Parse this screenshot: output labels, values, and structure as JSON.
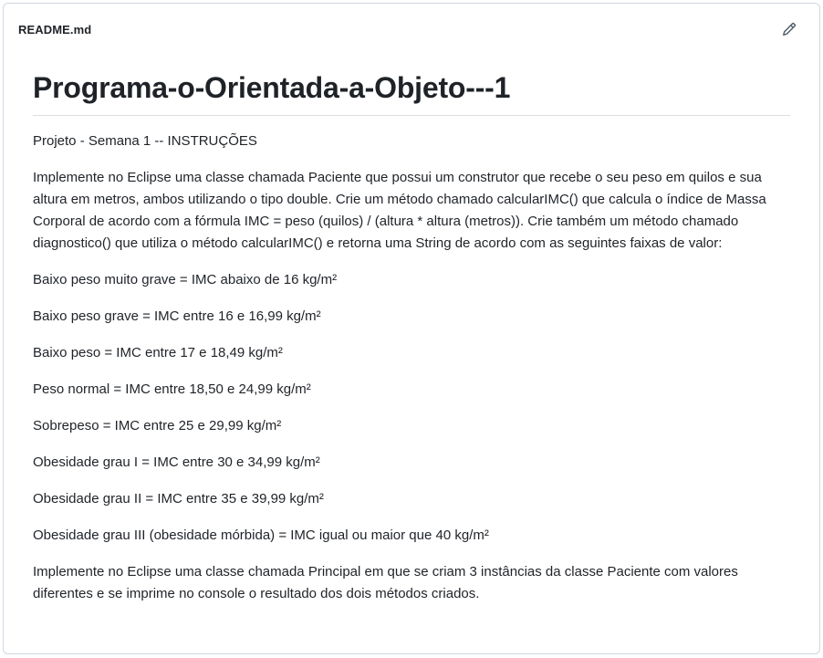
{
  "header": {
    "file_name": "README.md",
    "edit_icon": "pencil-icon"
  },
  "readme": {
    "title": "Programa-o-Orientada-a-Objeto---1",
    "paragraphs": [
      "Projeto - Semana 1 -- INSTRUÇÕES",
      "Implemente no Eclipse uma classe chamada Paciente que possui um construtor que recebe o seu peso em quilos e sua altura em metros, ambos utilizando o tipo double. Crie um método chamado calcularIMC() que calcula o índice de Massa Corporal de acordo com a fórmula IMC = peso (quilos) / (altura * altura (metros)). Crie também um método chamado diagnostico() que utiliza o método calcularIMC() e retorna uma String de acordo com as seguintes faixas de valor:",
      "Baixo peso muito grave = IMC abaixo de 16 kg/m²",
      "Baixo peso grave = IMC entre 16 e 16,99 kg/m²",
      "Baixo peso = IMC entre 17 e 18,49 kg/m²",
      "Peso normal = IMC entre 18,50 e 24,99 kg/m²",
      "Sobrepeso = IMC entre 25 e 29,99 kg/m²",
      "Obesidade grau I = IMC entre 30 e 34,99 kg/m²",
      "Obesidade grau II = IMC entre 35 e 39,99 kg/m²",
      "Obesidade grau III (obesidade mórbida) = IMC igual ou maior que 40 kg/m²",
      "Implemente no Eclipse uma classe chamada Principal em que se criam 3 instâncias da classe Paciente com valores diferentes e se imprime no console o resultado dos dois métodos criados."
    ]
  }
}
